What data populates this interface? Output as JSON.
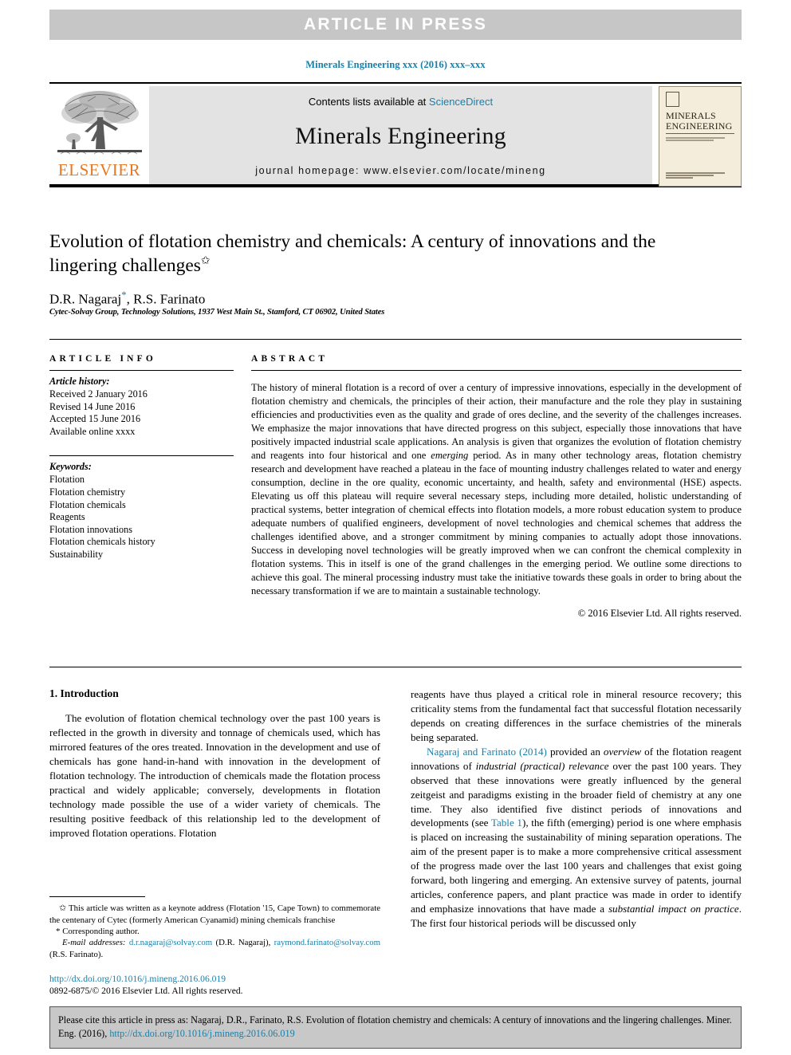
{
  "banner": {
    "text": "ARTICLE  IN  PRESS",
    "bg_color": "#c6c6c6",
    "text_color": "#ffffff"
  },
  "running_head": "Minerals Engineering xxx (2016) xxx–xxx",
  "masthead": {
    "publisher_name": "ELSEVIER",
    "publisher_color": "#e87722",
    "contents_prefix": "Contents lists available at ",
    "contents_link": "ScienceDirect",
    "journal_title": "Minerals Engineering",
    "homepage": "journal homepage: www.elsevier.com/locate/mineng",
    "cover": {
      "line1": "MINERALS",
      "line2": "ENGINEERING"
    },
    "accent_color": "#1a7fa8",
    "band_color": "#e3e3e3"
  },
  "article": {
    "title": "Evolution of flotation chemistry and chemicals: A century of innovations and the lingering challenges",
    "title_footnote_symbol": "✩",
    "authors": "D.R. Nagaraj",
    "authors_corresponding_symbol": "*",
    "authors_rest": ", R.S. Farinato",
    "affiliation": "Cytec-Solvay Group, Technology Solutions, 1937 West Main St., Stamford, CT 06902, United States"
  },
  "article_info": {
    "heading": "ARTICLE INFO",
    "history_label": "Article history:",
    "history": [
      "Received 2 January 2016",
      "Revised 14 June 2016",
      "Accepted 15 June 2016",
      "Available online xxxx"
    ],
    "keywords_label": "Keywords:",
    "keywords": [
      "Flotation",
      "Flotation chemistry",
      "Flotation chemicals",
      "Reagents",
      "Flotation innovations",
      "Flotation chemicals history",
      "Sustainability"
    ]
  },
  "abstract": {
    "heading": "ABSTRACT",
    "part1": "The history of mineral flotation is a record of over a century of impressive innovations, especially in the development of flotation chemistry and chemicals, the principles of their action, their manufacture and the role they play in sustaining efficiencies and productivities even as the quality and grade of ores decline, and the severity of the challenges increases. We emphasize the major innovations that have directed progress on this subject, especially those innovations that have positively impacted industrial scale applications. An analysis is given that organizes the evolution of flotation chemistry and reagents into four historical and one ",
    "emph1": "emerging",
    "part2": " period. As in many other technology areas, flotation chemistry research and development have reached a plateau in the face of mounting industry challenges related to water and energy consumption, decline in the ore quality, economic uncertainty, and health, safety and environmental (HSE) aspects. Elevating us off this plateau will require several necessary steps, including more detailed, holistic understanding of practical systems, better integration of chemical effects into flotation models, a more robust education system to produce adequate numbers of qualified engineers, development of novel technologies and chemical schemes that address the challenges identified above, and a stronger commitment by mining companies to actually adopt those innovations. Success in developing novel technologies will be greatly improved when we can confront the chemical complexity in flotation systems. This in itself is one of the grand challenges in the emerging period. We outline some directions to achieve this goal. The mineral processing industry must take the initiative towards these goals in order to bring about the necessary transformation if we are to maintain a sustainable technology.",
    "copyright": "© 2016 Elsevier Ltd. All rights reserved."
  },
  "body": {
    "section1_heading": "1. Introduction",
    "left_para": "The evolution of flotation chemical technology over the past 100 years is reflected in the growth in diversity and tonnage of chemicals used, which has mirrored features of the ores treated. Innovation in the development and use of chemicals has gone hand-in-hand with innovation in the development of flotation technology. The introduction of chemicals made the flotation process practical and widely applicable; conversely, developments in flotation technology made possible the use of a wider variety of chemicals. The resulting positive feedback of this relationship led to the development of improved flotation operations. Flotation",
    "right_para1": "reagents have thus played a critical role in mineral resource recovery; this criticality stems from the fundamental fact that successful flotation necessarily depends on creating differences in the surface chemistries of the minerals being separated.",
    "right_para2_link": "Nagaraj and Farinato (2014)",
    "right_para2_a": " provided an ",
    "right_para2_emph1": "overview",
    "right_para2_b": " of the flotation reagent innovations of ",
    "right_para2_emph2": "industrial (practical) relevance",
    "right_para2_c": " over the past 100 years. They observed that these innovations were greatly influenced by the general zeitgeist and paradigms existing in the broader field of chemistry at any one time. They also identified five distinct periods of innovations and developments (see ",
    "right_para2_link2": "Table 1",
    "right_para2_d": "), the fifth (emerging) period is one where emphasis is placed on increasing the sustainability of mining separation operations. The aim of the present paper is to make a more comprehensive critical assessment of the progress made over the last 100 years and challenges that exist going forward, both lingering and emerging. An extensive survey of patents, journal articles, conference papers, and plant practice was made in order to identify and emphasize innovations that have made a ",
    "right_para2_emph3": "substantial impact on practice",
    "right_para2_e": ". The first four historical periods will be discussed only"
  },
  "footnotes": {
    "star_symbol": "✩",
    "star_text": " This article was written as a keynote address (Flotation '15, Cape Town) to commemorate the centenary of Cytec (formerly American Cyanamid) mining chemicals franchise",
    "corresponding_symbol": "*",
    "corresponding_text": " Corresponding author.",
    "email_label": "E-mail addresses:",
    "email1": "d.r.nagaraj@solvay.com",
    "email1_owner": " (D.R. Nagaraj), ",
    "email2": "raymond.farinato@solvay.com",
    "email2_owner": " (R.S. Farinato).",
    "doi_url": "http://dx.doi.org/10.1016/j.mineng.2016.06.019",
    "issn_line": "0892-6875/© 2016 Elsevier Ltd. All rights reserved."
  },
  "cite_box": {
    "text": "Please cite this article in press as: Nagaraj, D.R., Farinato, R.S. Evolution of flotation chemistry and chemicals: A century of innovations and the lingering challenges. Miner. Eng. (2016), ",
    "doi": "http://dx.doi.org/10.1016/j.mineng.2016.06.019",
    "bg_color": "#c8c8c8"
  }
}
